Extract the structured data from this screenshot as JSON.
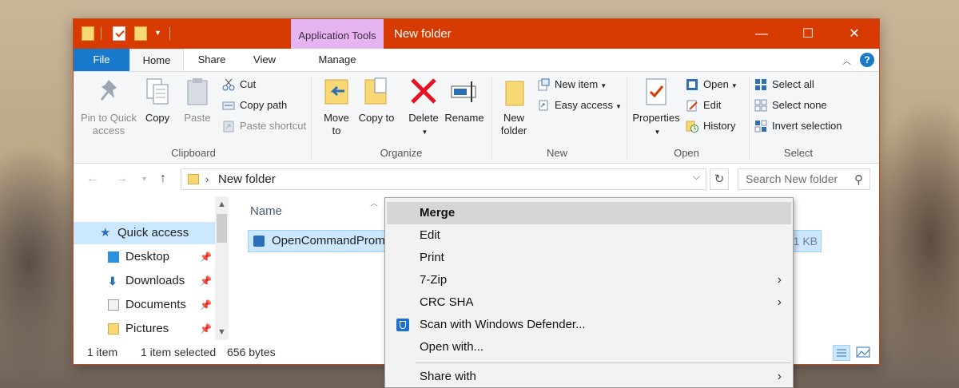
{
  "window": {
    "title": "New folder",
    "context_tab_label": "Application Tools",
    "minimize": "—",
    "maximize": "☐",
    "close": "✕"
  },
  "ribbon_tabs": [
    "File",
    "Home",
    "Share",
    "View",
    "Manage"
  ],
  "help": "?",
  "ribbon": {
    "clipboard": {
      "label": "Clipboard",
      "pin": "Pin to Quick access",
      "copy": "Copy",
      "paste": "Paste",
      "cut": "Cut",
      "copy_path": "Copy path",
      "paste_shortcut": "Paste shortcut"
    },
    "organize": {
      "label": "Organize",
      "move_to": "Move to",
      "copy_to": "Copy to",
      "delete": "Delete",
      "rename": "Rename"
    },
    "new": {
      "label": "New",
      "new_folder": "New folder",
      "new_item": "New item",
      "easy_access": "Easy access"
    },
    "open": {
      "label": "Open",
      "properties": "Properties",
      "open": "Open",
      "edit": "Edit",
      "history": "History"
    },
    "select": {
      "label": "Select",
      "select_all": "Select all",
      "select_none": "Select none",
      "invert_selection": "Invert selection"
    }
  },
  "address": {
    "path": "New folder",
    "search_placeholder": "Search New folder"
  },
  "navpane": {
    "items": [
      {
        "label": "Quick access"
      },
      {
        "label": "Desktop"
      },
      {
        "label": "Downloads"
      },
      {
        "label": "Documents"
      },
      {
        "label": "Pictures"
      }
    ]
  },
  "content": {
    "column_name": "Name",
    "file": {
      "name": "OpenCommandProm",
      "size": "1 KB"
    }
  },
  "status": {
    "count": "1 item",
    "selected": "1 item selected",
    "bytes": "656 bytes"
  },
  "context_menu": {
    "items": [
      {
        "label": "Merge"
      },
      {
        "label": "Edit"
      },
      {
        "label": "Print"
      },
      {
        "label": "7-Zip"
      },
      {
        "label": "CRC SHA"
      },
      {
        "label": "Scan with Windows Defender..."
      },
      {
        "label": "Open with..."
      },
      {
        "label": "Share with"
      }
    ]
  },
  "colors": {
    "titlebar": "#d83b01",
    "file_tab": "#1979ca",
    "context_tab": "#e6b4f0",
    "selection": "#cce8ff"
  }
}
